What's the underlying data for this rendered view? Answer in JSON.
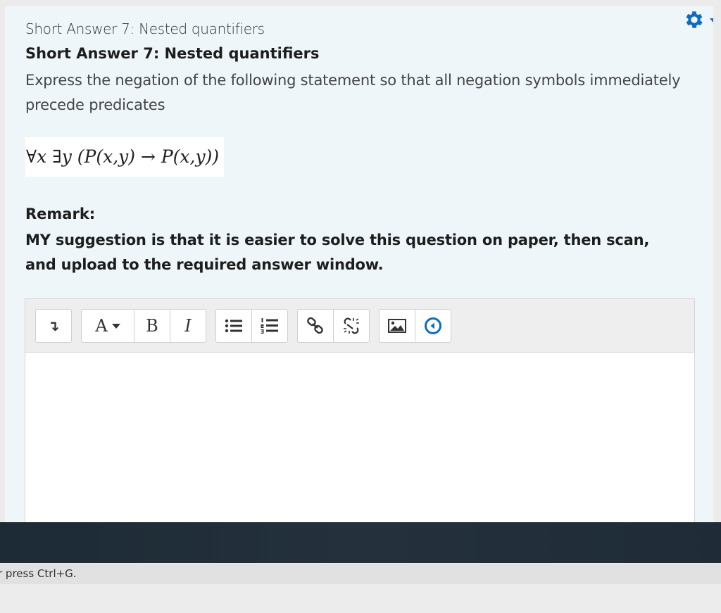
{
  "question": {
    "name": "Short Answer 7: Nested quantifiers",
    "title": "Short Answer 7: Nested quantifiers",
    "text": "Express the negation of the following statement so that all negation symbols immediately precede predicates",
    "formula": "∀x ∃y (P(x,y) → P(x,y))",
    "remark_heading": "Remark:",
    "remark_body": "MY suggestion is that it is easier  to solve this question on paper, then scan, and upload to the required answer window."
  },
  "header": {
    "settings_icon": "gear-icon"
  },
  "toolbar": {
    "groups": [
      {
        "buttons": [
          {
            "icon": "show-more-icon",
            "glyph": "↴"
          }
        ]
      },
      {
        "buttons": [
          {
            "icon": "font-style-icon",
            "glyph": "A"
          },
          {
            "icon": "bold-icon",
            "glyph": "B"
          },
          {
            "icon": "italic-icon",
            "glyph": "I"
          }
        ]
      },
      {
        "buttons": [
          {
            "icon": "unordered-list-icon"
          },
          {
            "icon": "ordered-list-icon"
          }
        ]
      },
      {
        "buttons": [
          {
            "icon": "link-icon"
          },
          {
            "icon": "unlink-icon"
          }
        ]
      },
      {
        "buttons": [
          {
            "icon": "image-icon"
          },
          {
            "icon": "record-media-icon"
          }
        ]
      }
    ]
  },
  "status_bar": {
    "text": "r press Ctrl+G."
  },
  "colors": {
    "accent": "#0f6cbf",
    "card_background": "#eef6fa",
    "dark_band": "#1f2c37"
  }
}
